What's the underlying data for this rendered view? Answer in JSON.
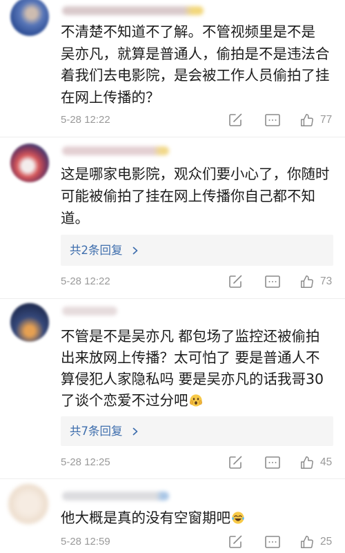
{
  "icons": {
    "share": "share-icon",
    "comment": "comment-icon",
    "like": "thumbs-up-icon",
    "reply_chevron": "chevron-right-icon"
  },
  "colors": {
    "text": "#1b1b1b",
    "meta": "#999999",
    "link": "#3e6ead",
    "reply_bg": "#f5f5f5",
    "divider": "#ededed"
  },
  "comments": [
    {
      "lines": [
        "不清楚不知道不了解。不管视频里是不是",
        "吴亦凡，就算是普通人，偷拍是不是违法合",
        "着我们去电影院，是会被工作人员偷拍了挂",
        "在网上传播的？"
      ],
      "time": "5-28 12:22",
      "likes": "77"
    },
    {
      "lines": [
        "这是哪家电影院，观众们要小心了，你随时",
        "可能被偷拍了挂在网上传播你自己都不知",
        "道。"
      ],
      "replies_label": "共2条回复",
      "time": "5-28 12:22",
      "likes": "73"
    },
    {
      "lines": [
        "不管是不是吴亦凡 都包场了监控还被偷拍",
        "出来放网上传播？太可怕了 要是普通人不",
        "算侵犯人家隐私吗 要是吴亦凡的话我哥30",
        "了谈个恋爱不过分吧"
      ],
      "trailing_emoji": "fearful-face-emoji",
      "replies_label": "共7条回复",
      "time": "5-28 12:25",
      "likes": "45"
    },
    {
      "lines": [
        "他大概是真的没有空窗期吧"
      ],
      "trailing_emoji": "laughing-tears-emoji",
      "time": "5-28 12:59",
      "likes": "25"
    }
  ]
}
